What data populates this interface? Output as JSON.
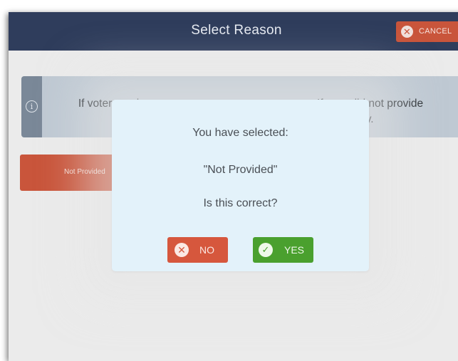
{
  "header": {
    "title": "Select Reason",
    "cancel_label": "CANCEL",
    "cancel_icon": "close-circle-icon"
  },
  "info": {
    "icon": "info-icon",
    "line1": "If voter provi                                   acceptable ID, tap  Provided. If voter did not provide",
    "line2": "an accept                                                                    provisionally."
  },
  "option": {
    "label": "Not Provided"
  },
  "dialog": {
    "line1": "You have selected:",
    "line2": "\"Not Provided\"",
    "line3": "Is this correct?",
    "no_label": "NO",
    "yes_label": "YES"
  },
  "colors": {
    "header": "#2f3d5c",
    "cancel": "#c9553b",
    "no": "#d6573d",
    "yes": "#4aa02e",
    "dialog": "#e3f2fa"
  }
}
